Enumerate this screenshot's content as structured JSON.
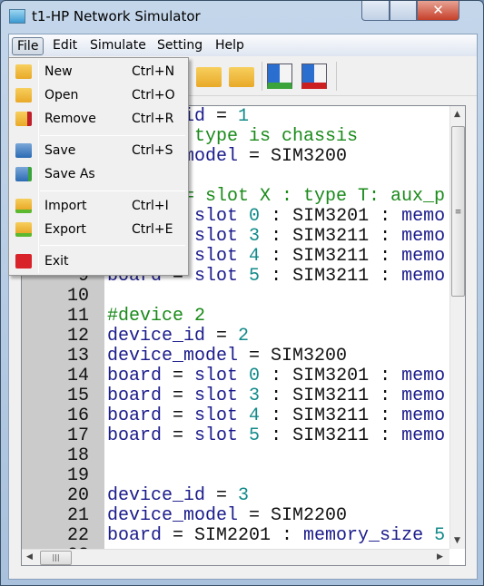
{
  "window": {
    "title": "t1-HP Network Simulator",
    "close_glyph": "✕"
  },
  "menubar": [
    "File",
    "Edit",
    "Simulate",
    "Setting",
    "Help"
  ],
  "file_menu": [
    {
      "label": "New",
      "shortcut": "Ctrl+N",
      "icon": "folder-gear-icon"
    },
    {
      "label": "Open",
      "shortcut": "Ctrl+O",
      "icon": "folder-icon"
    },
    {
      "label": "Remove",
      "shortcut": "Ctrl+R",
      "icon": "folder-remove-icon"
    },
    {
      "label": "Save",
      "shortcut": "Ctrl+S",
      "icon": "save-icon"
    },
    {
      "label": "Save As",
      "shortcut": "",
      "icon": "save-as-icon"
    },
    {
      "label": "Import",
      "shortcut": "Ctrl+I",
      "icon": "import-icon"
    },
    {
      "label": "Export",
      "shortcut": "Ctrl+E",
      "icon": "export-icon"
    },
    {
      "label": "Exit",
      "shortcut": "",
      "icon": "exit-icon"
    }
  ],
  "toolbar": [
    "import-icon",
    "export-icon",
    "start-simulation-icon",
    "stop-simulation-icon"
  ],
  "colors": {
    "keyword": "#1b1b8c",
    "number": "#138a8a",
    "comment": "#1a8a1a",
    "gutter": "#cbcbcb"
  },
  "editor": {
    "lines": [
      {
        "n": "1",
        "tokens": [
          [
            "kw",
            "device_id"
          ],
          [
            "id",
            " = "
          ],
          [
            "num",
            "1"
          ]
        ]
      },
      {
        "n": "2",
        "tokens": [
          [
            "cm",
            "#device type is chassis"
          ]
        ]
      },
      {
        "n": "3",
        "tokens": [
          [
            "kw",
            "device_model"
          ],
          [
            "id",
            " = SIM3200"
          ]
        ]
      },
      {
        "n": "4",
        "tokens": []
      },
      {
        "n": "5",
        "tokens": [
          [
            "cm",
            "#board = slot X : type T: aux_p"
          ]
        ]
      },
      {
        "n": "6",
        "tokens": [
          [
            "kw",
            "board"
          ],
          [
            "id",
            " = "
          ],
          [
            "kw",
            "slot "
          ],
          [
            "num",
            "0"
          ],
          [
            "id",
            " : SIM3201 : "
          ],
          [
            "kw",
            "memo"
          ]
        ]
      },
      {
        "n": "7",
        "tokens": [
          [
            "kw",
            "board"
          ],
          [
            "id",
            " = "
          ],
          [
            "kw",
            "slot "
          ],
          [
            "num",
            "3"
          ],
          [
            "id",
            " : SIM3211 : "
          ],
          [
            "kw",
            "memo"
          ]
        ]
      },
      {
        "n": "8",
        "tokens": [
          [
            "kw",
            "board"
          ],
          [
            "id",
            " = "
          ],
          [
            "kw",
            "slot "
          ],
          [
            "num",
            "4"
          ],
          [
            "id",
            " : SIM3211 : "
          ],
          [
            "kw",
            "memo"
          ]
        ]
      },
      {
        "n": "9",
        "tokens": [
          [
            "kw",
            "board"
          ],
          [
            "id",
            " = "
          ],
          [
            "kw",
            "slot "
          ],
          [
            "num",
            "5"
          ],
          [
            "id",
            " : SIM3211 : "
          ],
          [
            "kw",
            "memo"
          ]
        ]
      },
      {
        "n": "10",
        "tokens": []
      },
      {
        "n": "11",
        "tokens": [
          [
            "cm",
            "#device 2"
          ]
        ]
      },
      {
        "n": "12",
        "tokens": [
          [
            "kw",
            "device_id"
          ],
          [
            "id",
            " = "
          ],
          [
            "num",
            "2"
          ]
        ]
      },
      {
        "n": "13",
        "tokens": [
          [
            "kw",
            "device_model"
          ],
          [
            "id",
            " = SIM3200"
          ]
        ]
      },
      {
        "n": "14",
        "tokens": [
          [
            "kw",
            "board"
          ],
          [
            "id",
            " = "
          ],
          [
            "kw",
            "slot "
          ],
          [
            "num",
            "0"
          ],
          [
            "id",
            " : SIM3201 : "
          ],
          [
            "kw",
            "memo"
          ]
        ]
      },
      {
        "n": "15",
        "tokens": [
          [
            "kw",
            "board"
          ],
          [
            "id",
            " = "
          ],
          [
            "kw",
            "slot "
          ],
          [
            "num",
            "3"
          ],
          [
            "id",
            " : SIM3211 : "
          ],
          [
            "kw",
            "memo"
          ]
        ]
      },
      {
        "n": "16",
        "tokens": [
          [
            "kw",
            "board"
          ],
          [
            "id",
            " = "
          ],
          [
            "kw",
            "slot "
          ],
          [
            "num",
            "4"
          ],
          [
            "id",
            " : SIM3211 : "
          ],
          [
            "kw",
            "memo"
          ]
        ]
      },
      {
        "n": "17",
        "tokens": [
          [
            "kw",
            "board"
          ],
          [
            "id",
            " = "
          ],
          [
            "kw",
            "slot "
          ],
          [
            "num",
            "5"
          ],
          [
            "id",
            " : SIM3211 : "
          ],
          [
            "kw",
            "memo"
          ]
        ]
      },
      {
        "n": "18",
        "tokens": []
      },
      {
        "n": "19",
        "tokens": []
      },
      {
        "n": "20",
        "tokens": [
          [
            "kw",
            "device_id"
          ],
          [
            "id",
            " = "
          ],
          [
            "num",
            "3"
          ]
        ]
      },
      {
        "n": "21",
        "tokens": [
          [
            "kw",
            "device_model"
          ],
          [
            "id",
            " = SIM2200"
          ]
        ]
      },
      {
        "n": "22",
        "tokens": [
          [
            "kw",
            "board"
          ],
          [
            "id",
            " = SIM2201 : "
          ],
          [
            "kw",
            "memory_size "
          ],
          [
            "num",
            "5"
          ]
        ]
      },
      {
        "n": "23",
        "tokens": []
      }
    ]
  }
}
